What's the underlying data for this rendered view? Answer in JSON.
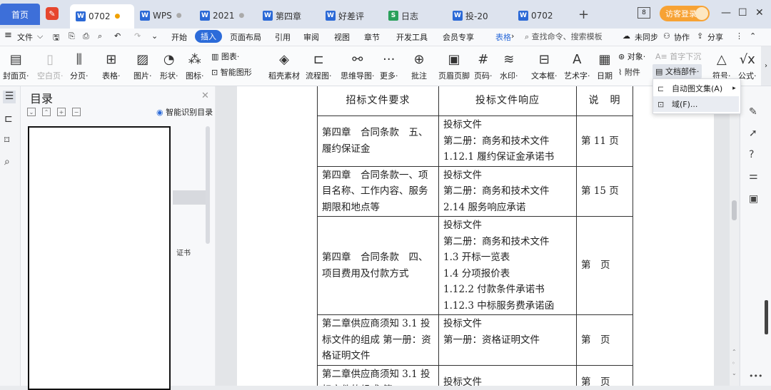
{
  "tabs": {
    "home": "首页",
    "items": [
      {
        "label": "0702",
        "type": "W",
        "active": true
      },
      {
        "label": "WPS",
        "type": "W"
      },
      {
        "label": "2021",
        "type": "W"
      },
      {
        "label": "第四章",
        "type": "W"
      },
      {
        "label": "好差评",
        "type": "W"
      },
      {
        "label": "日志",
        "type": "S"
      },
      {
        "label": "投-20",
        "type": "W"
      },
      {
        "label": "0702",
        "type": "W"
      }
    ],
    "page_counter": "8",
    "login": "访客登录"
  },
  "menubar": {
    "file": "文件",
    "items": [
      "开始",
      "插入",
      "页面布局",
      "引用",
      "审阅",
      "视图",
      "章节",
      "开发工具",
      "会员专享",
      "表格"
    ],
    "active": "插入",
    "search": "查找命令、搜索模板",
    "unsync": "未同步",
    "collab": "协作",
    "share": "分享"
  },
  "ribbon": {
    "cover": "封面页",
    "blank": "空白页",
    "pagebreak": "分页",
    "table": "表格",
    "picture": "图片",
    "shape": "形状",
    "icon": "图标",
    "chart": "图表",
    "smartart": "智能图形",
    "material": "稻壳素材",
    "flowchart": "流程图",
    "mindmap": "思维导图",
    "more": "更多",
    "comment": "批注",
    "headerfooter": "页眉页脚",
    "pagenum": "页码",
    "watermark": "水印",
    "textbox": "文本框",
    "wordart": "艺术字",
    "date": "日期",
    "object": "对象",
    "attachment": "附件",
    "dropcap": "首字下沉",
    "docparts": "文档部件",
    "symbol": "符号",
    "formula": "公式"
  },
  "toc": {
    "title": "目录",
    "smart": "智能识别目录",
    "snippet": "证书"
  },
  "dropdown": {
    "items": [
      "自动图文集(A)",
      "域(F)..."
    ]
  },
  "document": {
    "headers": [
      "招标文件要求",
      "投标文件响应",
      "说　明"
    ],
    "rows": [
      {
        "req": "第四章　合同条款　五、履约保证金",
        "resp": [
          "投标文件",
          "第二册：商务和技术文件",
          "1.12.1 履约保证金承诺书"
        ],
        "note": "第 11 页"
      },
      {
        "req": "第四章　合同条款一、项目名称、工作内容、服务期限和地点等",
        "resp": [
          "投标文件",
          "第二册：商务和技术文件",
          "2.14 服务响应承诺"
        ],
        "note": "第 15 页"
      },
      {
        "req": "第四章　合同条款　四、项目费用及付款方式",
        "resp": [
          "投标文件",
          "第二册：商务和技术文件",
          "1.3 开标一览表",
          "1.4 分项报价表",
          "1.12.2 付款条件承诺书",
          "1.12.3 中标服务费承诺函"
        ],
        "note": "第　页"
      },
      {
        "req": "第二章供应商须知 3.1 投标文件的组成 第一册：资格证明文件",
        "resp": [
          "投标文件",
          "第一册：资格证明文件"
        ],
        "note": "第　页"
      },
      {
        "req": "第二章供应商须知 3.1 投标文件的组成 第一",
        "resp": [
          "投标文件"
        ],
        "note": "第　页"
      }
    ]
  }
}
